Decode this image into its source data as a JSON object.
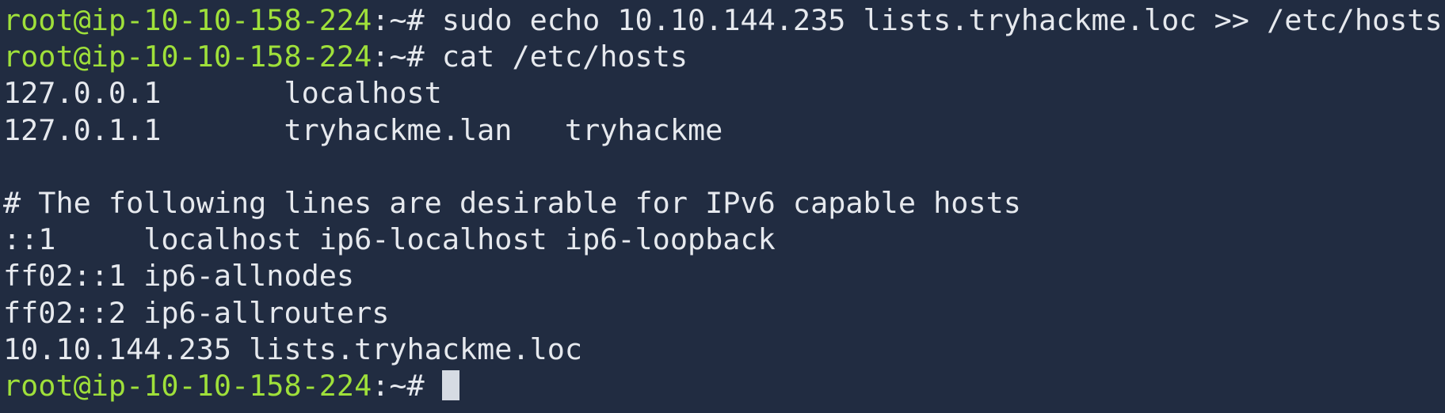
{
  "colors": {
    "background": "#212c41",
    "text": "#e6e9ee",
    "prompt_user": "#9fe03a",
    "cursor": "#d6dbe3"
  },
  "terminal": {
    "prompts": [
      {
        "user_host": "root@ip-10-10-158-224",
        "path_symbol": ":~# ",
        "command": "sudo echo 10.10.144.235 lists.tryhackme.loc >> /etc/hosts"
      },
      {
        "user_host": "root@ip-10-10-158-224",
        "path_symbol": ":~# ",
        "command": "cat /etc/hosts"
      },
      {
        "user_host": "root@ip-10-10-158-224",
        "path_symbol": ":~# ",
        "command": ""
      }
    ],
    "output": [
      "127.0.0.1       localhost",
      "127.0.1.1       tryhackme.lan   tryhackme",
      "",
      "# The following lines are desirable for IPv6 capable hosts",
      "::1     localhost ip6-localhost ip6-loopback",
      "ff02::1 ip6-allnodes",
      "ff02::2 ip6-allrouters",
      "10.10.144.235 lists.tryhackme.loc"
    ]
  }
}
